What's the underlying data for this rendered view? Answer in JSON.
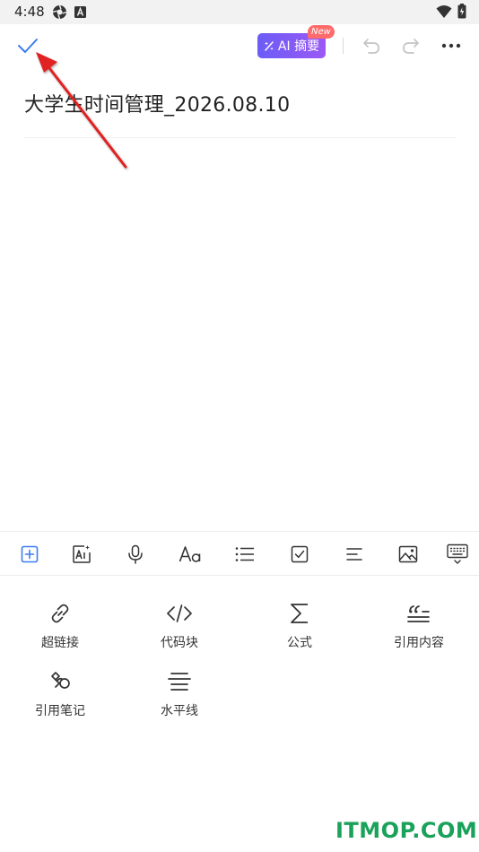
{
  "status_bar": {
    "time": "4:48"
  },
  "header": {
    "ai_summary_label": "AI 摘要",
    "new_badge": "New"
  },
  "note": {
    "title": "大学生时间管理_2026.08.10"
  },
  "toolbar": {
    "items": [
      "insert-icon",
      "ai-text-icon",
      "microphone-icon",
      "font-style-icon",
      "bullet-list-icon",
      "checkbox-icon",
      "align-icon",
      "image-icon",
      "keyboard-icon"
    ]
  },
  "insert_panel": {
    "items": [
      {
        "label": "超链接",
        "icon": "link-icon"
      },
      {
        "label": "代码块",
        "icon": "code-icon"
      },
      {
        "label": "公式",
        "icon": "sigma-icon"
      },
      {
        "label": "引用内容",
        "icon": "quote-icon"
      },
      {
        "label": "引用笔记",
        "icon": "note-link-icon"
      },
      {
        "label": "水平线",
        "icon": "horizontal-line-icon"
      }
    ]
  },
  "watermark": {
    "text": "ITMOP.COM"
  },
  "colors": {
    "accent": "#3b7cf0",
    "ai_start": "#6c5cf6",
    "ai_end": "#9b59f5",
    "badge": "#ff6b6b",
    "watermark": "#1aa25a"
  }
}
